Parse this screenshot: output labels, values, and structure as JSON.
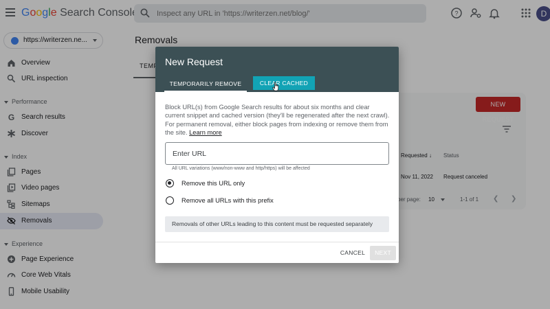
{
  "colors": {
    "accent": "#4285f4",
    "dialog_header": "#3c5055",
    "active_tab": "#12a3b5",
    "danger": "#c62828",
    "active_nav": "#e8eaf6"
  },
  "header": {
    "logo_google": [
      "G",
      "o",
      "o",
      "g",
      "l",
      "e"
    ],
    "logo_rest": " Search Console",
    "search_placeholder": "Inspect any URL in 'https://writerzen.net/blog/'",
    "icons": [
      "help-icon",
      "manage-users-icon",
      "notifications-icon",
      "apps-grid-icon"
    ],
    "avatar_letter": "D"
  },
  "sidebar": {
    "property": "https://writerzen.ne...",
    "items_top": [
      {
        "label": "Overview",
        "icon": "home-icon"
      },
      {
        "label": "URL inspection",
        "icon": "search-icon"
      }
    ],
    "section_performance": "Performance",
    "items_performance": [
      {
        "label": "Search results",
        "icon": "google-g-icon"
      },
      {
        "label": "Discover",
        "icon": "asterisk-icon"
      }
    ],
    "section_index": "Index",
    "items_index": [
      {
        "label": "Pages",
        "icon": "pages-icon"
      },
      {
        "label": "Video pages",
        "icon": "video-pages-icon"
      },
      {
        "label": "Sitemaps",
        "icon": "sitemap-icon"
      },
      {
        "label": "Removals",
        "icon": "eye-off-icon"
      }
    ],
    "section_experience": "Experience",
    "items_experience": [
      {
        "label": "Page Experience",
        "icon": "plus-circle-icon"
      },
      {
        "label": "Core Web Vitals",
        "icon": "gauge-icon"
      },
      {
        "label": "Mobile Usability",
        "icon": "phone-icon"
      }
    ]
  },
  "main": {
    "title": "Removals",
    "tab_visible": "TEMP",
    "new_request_btn": "NEW REQUEST",
    "columns": {
      "requested": "Requested",
      "status": "Status"
    },
    "row": {
      "date": "Nov 11, 2022",
      "status": "Request canceled"
    },
    "pagination": {
      "rows_label": "ber page:",
      "rows_value": "10",
      "range": "1-1 of 1"
    }
  },
  "dialog": {
    "title": "New Request",
    "tabs": [
      "TEMPORARILY REMOVE URL",
      "CLEAR CACHED URL"
    ],
    "description": "Block URL(s) from Google Search results for about six months and clear current snippet and cached version (they'll be regenerated after the next crawl). For permanent removal, either block pages from indexing or remove them from the site. ",
    "learn_more": "Learn more",
    "url_placeholder": "Enter URL",
    "url_help": "All URL variations (www/non-www and http/https) will be affected",
    "options": [
      "Remove this URL only",
      "Remove all URLs with this prefix"
    ],
    "selected_option": "Remove this URL only",
    "note": "Removals of other URLs leading to this content must be requested separately",
    "cancel_label": "CANCEL",
    "next_label": "NEXT"
  }
}
